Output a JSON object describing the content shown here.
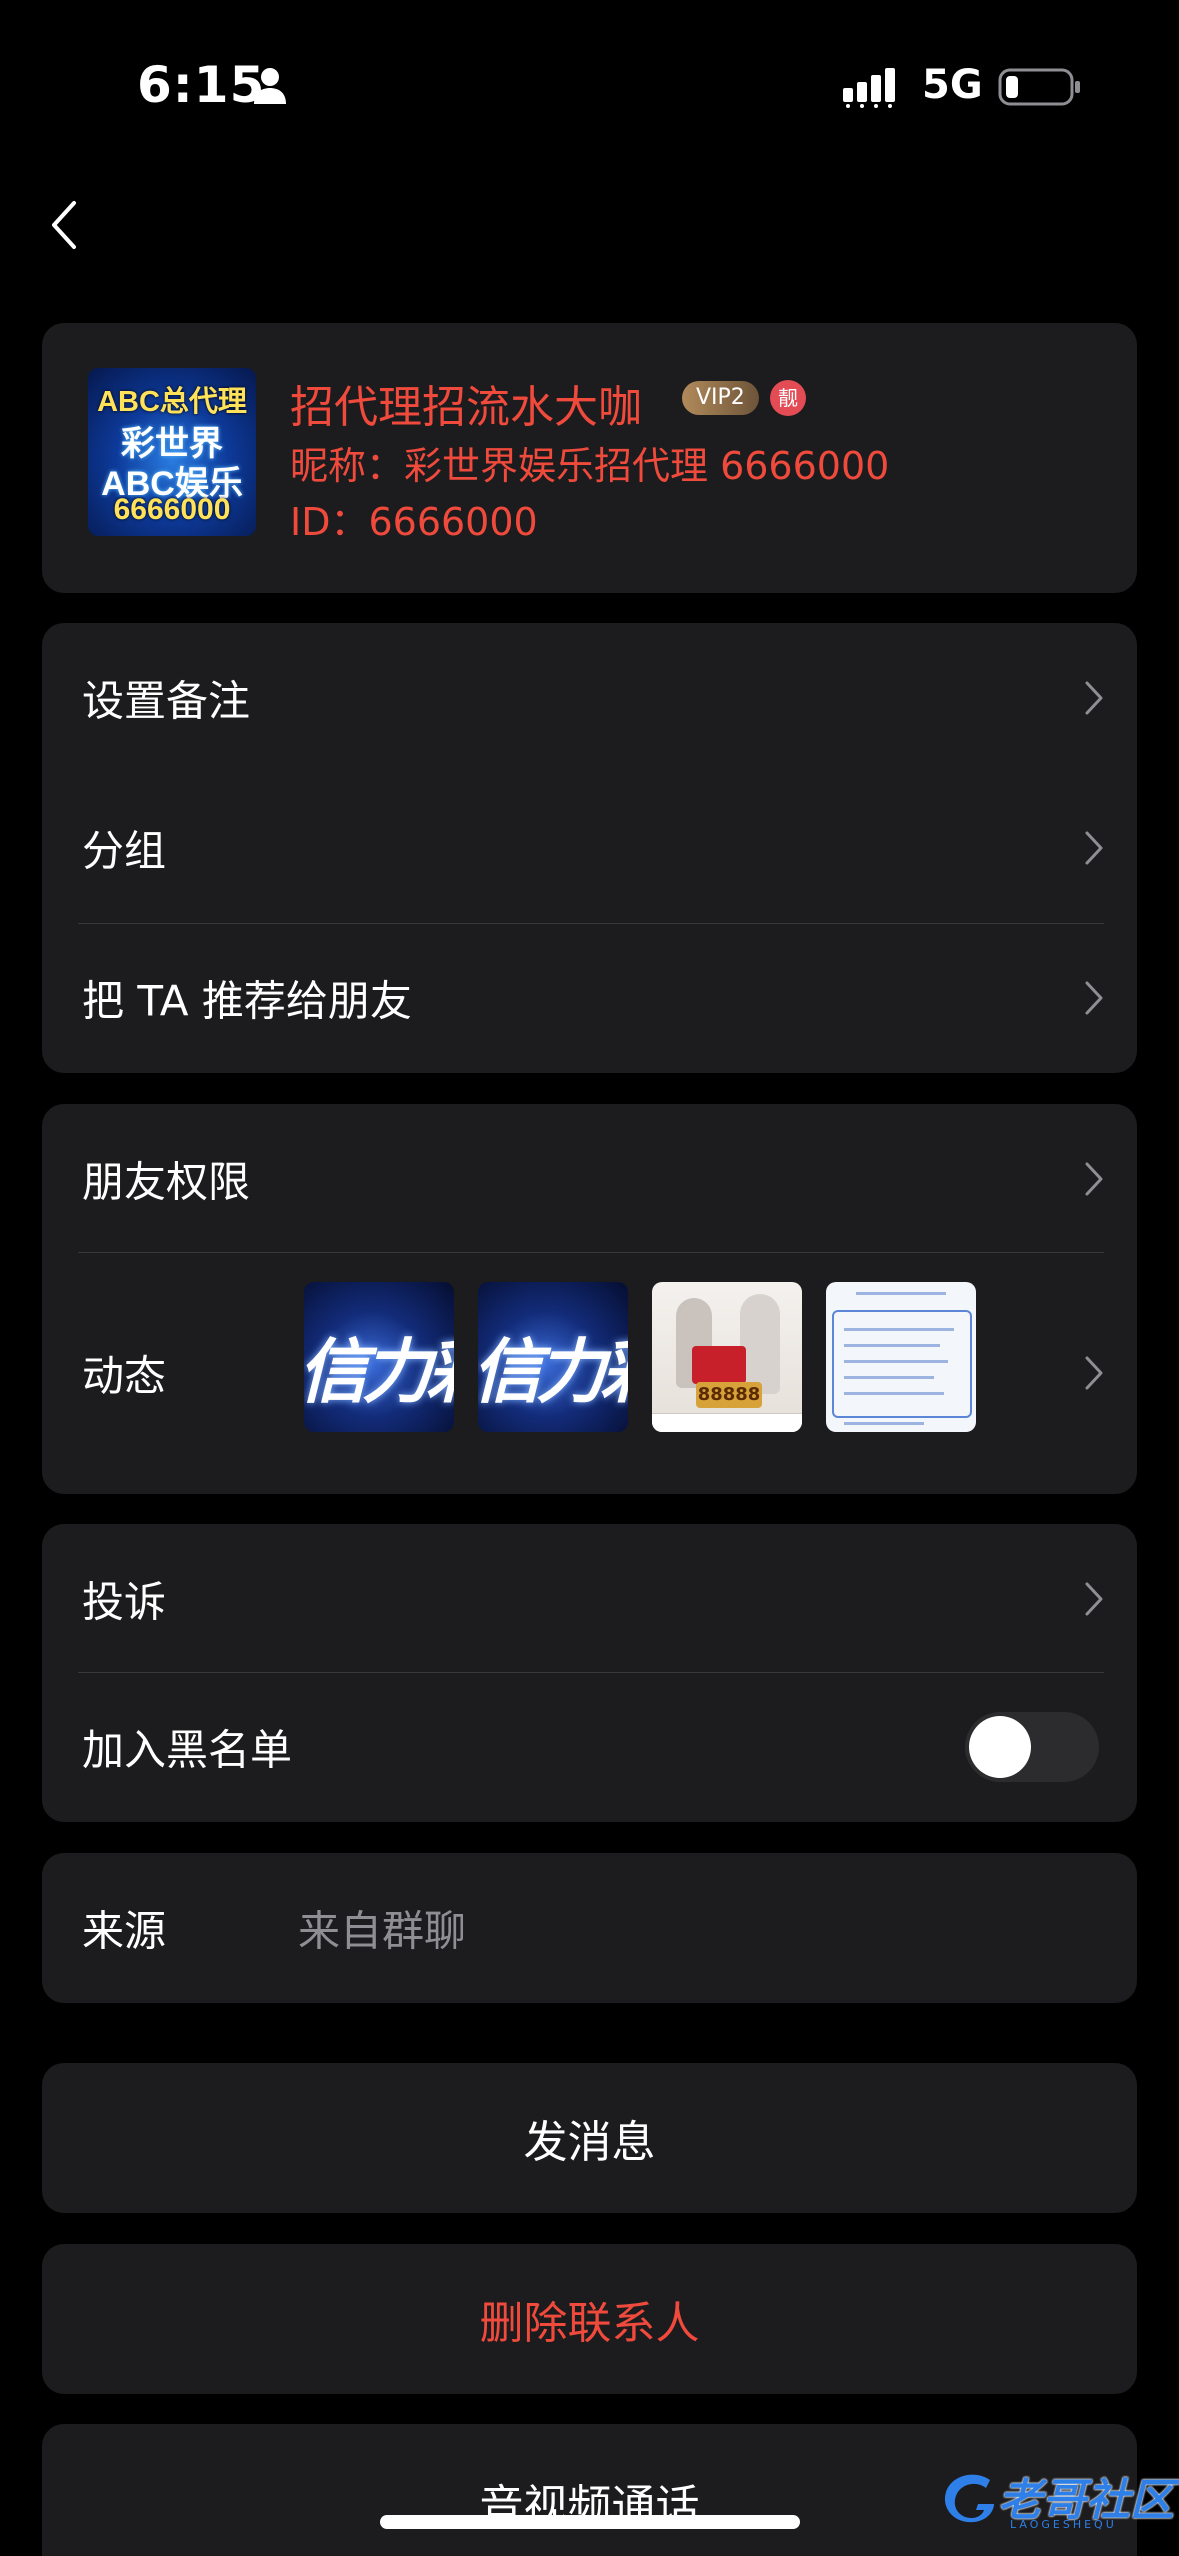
{
  "status_bar": {
    "time": "6:15",
    "network": "5G"
  },
  "profile": {
    "avatar_text": [
      "ABC总代理",
      "彩世界",
      "ABC娱乐",
      "6666000"
    ],
    "name": "招代理招流水大咖",
    "vip_badge": "VIP2",
    "liang_badge": "靓",
    "nickname": "昵称：彩世界娱乐招代理 6666000",
    "id": "ID：6666000"
  },
  "settings_group": [
    {
      "label": "设置备注"
    },
    {
      "label": "分组"
    },
    {
      "label": "把 TA 推荐给朋友"
    }
  ],
  "privacy_group": {
    "permissions_label": "朋友权限",
    "moments_label": "动态",
    "moment_thumbs": [
      {
        "text": "信力彩"
      },
      {
        "text": "信力彩"
      },
      {
        "text": "88888"
      },
      {
        "text": ""
      }
    ]
  },
  "report_group": {
    "complaint_label": "投诉",
    "blacklist_label": "加入黑名单",
    "blacklist_enabled": false
  },
  "source": {
    "label": "来源",
    "value": "来自群聊"
  },
  "actions": {
    "message": "发消息",
    "delete": "删除联系人",
    "call": "音视频通话"
  },
  "watermark": {
    "text": "老哥社区",
    "sub": "LAOGESHEQU"
  },
  "colors": {
    "background": "#000000",
    "card": "#1c1c1e",
    "accent_red": "#f04a3c",
    "secondary_text": "#8e8e93",
    "divider": "#38383a"
  }
}
